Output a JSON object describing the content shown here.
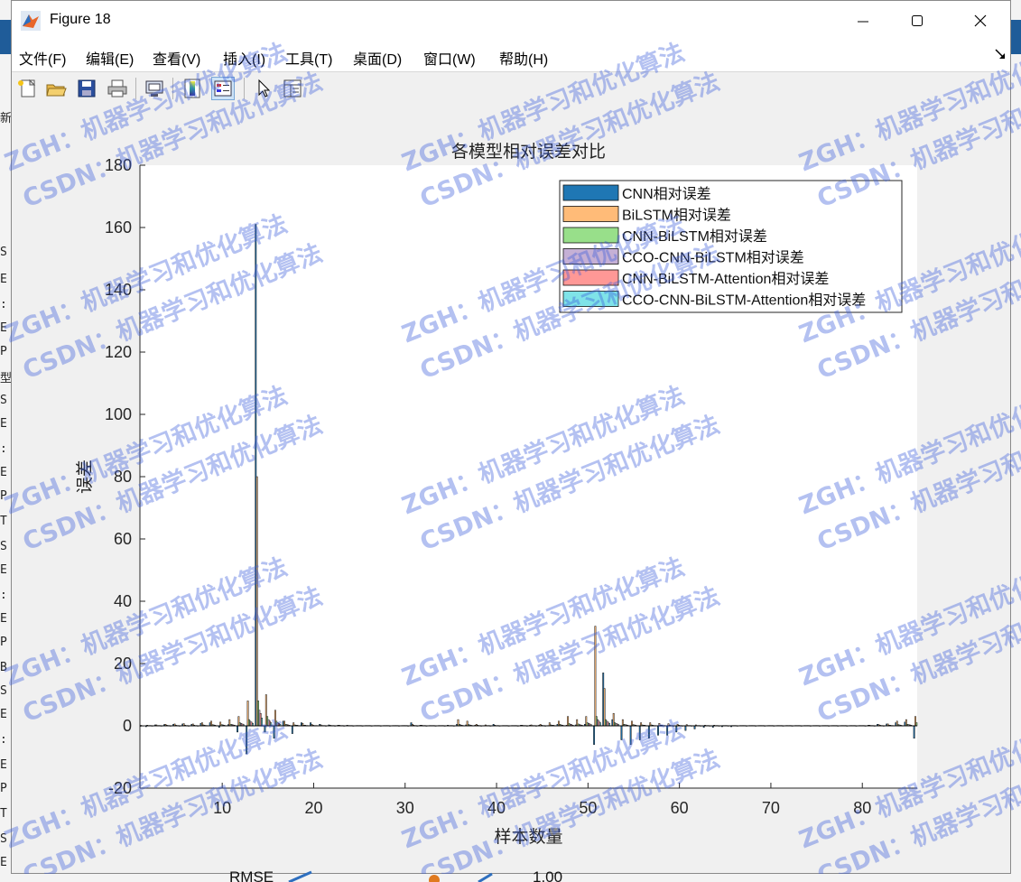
{
  "window": {
    "title": "Figure 18",
    "icon": "matlab-logo-icon",
    "controls": [
      "minimize-icon",
      "maximize-icon",
      "close-icon"
    ]
  },
  "menu": [
    {
      "label": "文件(F)"
    },
    {
      "label": "编辑(E)"
    },
    {
      "label": "查看(V)"
    },
    {
      "label": "插入(I)"
    },
    {
      "label": "工具(T)"
    },
    {
      "label": "桌面(D)"
    },
    {
      "label": "窗口(W)"
    },
    {
      "label": "帮助(H)"
    }
  ],
  "toolbar": [
    "new-figure-icon",
    "open-file-icon",
    "save-icon",
    "print-icon",
    "link-plot-icon",
    "insert-colorbar-icon",
    "insert-legend-icon",
    "edit-plot-icon",
    "property-inspector-icon"
  ],
  "background": {
    "left_glyphs": [
      "新",
      "S",
      "E",
      ":",
      "E",
      "P",
      "型",
      "S",
      "E",
      ":",
      "E",
      "P",
      "T",
      "S",
      "E",
      ":",
      "E",
      "P",
      "B",
      "S",
      "E",
      ":",
      "E",
      "P",
      "T",
      "S",
      "E"
    ],
    "bottom_text": [
      "RMSE",
      "1.00"
    ]
  },
  "watermark": "ZGH：机器学习和优化算法",
  "watermark2": "CSDN：机器学习和优化算法",
  "colors": {
    "cnn": "#1f77b4",
    "bilstm": "#ffbb78",
    "cnn_bilstm": "#98df8a",
    "cco_cnn_bilstm": "#c5b0d5",
    "cnn_bilstm_att": "#ff9896",
    "cco_cnn_bilstm_att": "#7fe3e8",
    "watermark": "#3b5bdb"
  },
  "chart_data": {
    "type": "bar",
    "title": "各模型相对误差对比",
    "xlabel": "样本数量",
    "ylabel": "误差",
    "xlim": [
      1,
      86
    ],
    "ylim": [
      -20,
      180
    ],
    "xticks": [
      10,
      20,
      30,
      40,
      50,
      60,
      70,
      80
    ],
    "yticks": [
      -20,
      0,
      20,
      40,
      60,
      80,
      100,
      120,
      140,
      160,
      180
    ],
    "legend_position": "top-right",
    "grid": false,
    "series": [
      {
        "name": "CNN相对误差",
        "values": [
          -0.2,
          -0.3,
          0.3,
          0.4,
          0.5,
          0.6,
          0.5,
          0.8,
          1,
          -0.5,
          0.4,
          -2,
          -9,
          161,
          -2,
          -4,
          1.5,
          -2.5,
          1,
          1,
          0.5,
          0.3,
          0.2,
          0.2,
          0.1,
          0.1,
          0.1,
          0.1,
          0.1,
          0.1,
          1,
          0.2,
          0.1,
          0.1,
          0.2,
          0.5,
          0.3,
          0.2,
          0.1,
          0.5,
          0.1,
          0.1,
          0.2,
          0.2,
          0.2,
          0.1,
          0.5,
          0.2,
          0.3,
          0.5,
          -6,
          17,
          2,
          -4.5,
          -6,
          -4.5,
          -4,
          -3,
          -3,
          -2,
          -1.5,
          -1,
          -0.5,
          -0.5,
          -0.3,
          -0.3,
          0.1,
          0.1,
          0.1,
          0.1,
          0.1,
          0.1,
          0.1,
          0.1,
          0.1,
          0.1,
          0.1,
          0.1,
          0.1,
          0.1,
          0.2,
          0.5,
          0.6,
          1,
          1.2,
          -4
        ]
      },
      {
        "name": "BiLSTM相对误差",
        "values": [
          0.2,
          0.2,
          0.3,
          0.5,
          0.6,
          0.7,
          0.6,
          1,
          1.5,
          1.2,
          2,
          3,
          8,
          80,
          10,
          5,
          1.5,
          1,
          0.8,
          0.5,
          0.3,
          0.2,
          0.2,
          0.1,
          0.1,
          0.1,
          0.1,
          0.1,
          0.1,
          0.1,
          0.5,
          0.2,
          0.1,
          0.1,
          0.1,
          2,
          1.5,
          0.5,
          0.3,
          0.2,
          0.1,
          0.1,
          0.2,
          0.3,
          0.5,
          1,
          1.5,
          3,
          2,
          3,
          32,
          12,
          4,
          2,
          1.5,
          1,
          1,
          0.8,
          0.7,
          0.5,
          0.4,
          0.3,
          0.2,
          0.2,
          0.1,
          0.1,
          0.1,
          0.1,
          0.1,
          0.1,
          0.1,
          0.1,
          0.1,
          0.1,
          0.1,
          0.1,
          0.1,
          0.1,
          0.1,
          0.1,
          0.2,
          0.4,
          0.6,
          1.5,
          2,
          3
        ]
      },
      {
        "name": "CNN-BiLSTM相对误差",
        "values": [
          0.1,
          0.1,
          0.1,
          0.2,
          0.2,
          0.2,
          0.2,
          0.3,
          0.4,
          0.4,
          0.5,
          1,
          2,
          8,
          3,
          1.5,
          0.5,
          0.3,
          0.2,
          0.2,
          0.1,
          0.1,
          0.1,
          0.1,
          0.1,
          0.1,
          0.1,
          0.1,
          0.1,
          0.1,
          0.2,
          0.1,
          0.1,
          0.1,
          0.1,
          0.5,
          0.4,
          0.2,
          0.1,
          0.1,
          0.1,
          0.1,
          0.1,
          0.1,
          0.2,
          0.3,
          0.5,
          0.8,
          0.6,
          1,
          3,
          2,
          1,
          0.5,
          0.4,
          0.3,
          0.3,
          0.2,
          0.2,
          0.2,
          0.1,
          0.1,
          0.1,
          0.1,
          0.1,
          0.1,
          0.1,
          0.1,
          0.1,
          0.1,
          0.1,
          0.1,
          0.1,
          0.1,
          0.1,
          0.1,
          0.1,
          0.1,
          0.1,
          0.1,
          0.1,
          0.2,
          0.2,
          0.4,
          0.5,
          1
        ]
      },
      {
        "name": "CCO-CNN-BiLSTM相对误差",
        "values": [
          0.1,
          0.1,
          0.1,
          0.1,
          0.1,
          0.1,
          0.1,
          0.2,
          0.3,
          0.3,
          0.4,
          0.8,
          1.5,
          5,
          2,
          1,
          0.4,
          0.2,
          0.2,
          0.1,
          0.1,
          0.1,
          0.1,
          0.1,
          0.1,
          0.1,
          0.1,
          0.1,
          0.1,
          0.1,
          0.1,
          0.1,
          0.1,
          0.1,
          0.1,
          0.3,
          0.3,
          0.1,
          0.1,
          0.1,
          0.1,
          0.1,
          0.1,
          0.1,
          0.1,
          0.2,
          0.3,
          0.5,
          0.4,
          0.8,
          2,
          1.5,
          0.8,
          0.4,
          0.3,
          0.2,
          0.2,
          0.2,
          0.1,
          0.1,
          0.1,
          0.1,
          0.1,
          0.1,
          0.1,
          0.1,
          0.1,
          0.1,
          0.1,
          0.1,
          0.1,
          0.1,
          0.1,
          0.1,
          0.1,
          0.1,
          0.1,
          0.1,
          0.1,
          0.1,
          0.1,
          0.1,
          0.2,
          0.3,
          0.4,
          0.8
        ]
      },
      {
        "name": "CNN-BiLSTM-Attention相对误差",
        "values": [
          0.1,
          0.1,
          0.1,
          0.1,
          0.1,
          0.1,
          0.1,
          0.1,
          0.2,
          0.2,
          0.3,
          0.6,
          1.2,
          4,
          1.5,
          0.8,
          0.3,
          0.2,
          0.1,
          0.1,
          0.1,
          0.1,
          0.1,
          0.1,
          0.1,
          0.1,
          0.1,
          0.1,
          0.1,
          0.1,
          0.1,
          0.1,
          0.1,
          0.1,
          0.1,
          0.2,
          0.2,
          0.1,
          0.1,
          0.1,
          0.1,
          0.1,
          0.1,
          0.1,
          0.1,
          0.2,
          0.2,
          0.4,
          0.3,
          0.6,
          1.5,
          1.2,
          0.6,
          0.3,
          0.2,
          0.2,
          0.1,
          0.1,
          0.1,
          0.1,
          0.1,
          0.1,
          0.1,
          0.1,
          0.1,
          0.1,
          0.1,
          0.1,
          0.1,
          0.1,
          0.1,
          0.1,
          0.1,
          0.1,
          0.1,
          0.1,
          0.1,
          0.1,
          0.1,
          0.1,
          0.1,
          0.1,
          0.1,
          0.2,
          0.3,
          0.6
        ]
      },
      {
        "name": "CCO-CNN-BiLSTM-Attention相对误差",
        "values": [
          0.05,
          0.05,
          0.05,
          0.05,
          0.05,
          0.05,
          0.05,
          0.1,
          0.1,
          0.1,
          0.2,
          0.4,
          0.8,
          2.5,
          1,
          0.5,
          0.2,
          0.1,
          0.1,
          0.1,
          0.05,
          0.05,
          0.05,
          0.05,
          0.05,
          0.05,
          0.05,
          0.05,
          0.05,
          0.05,
          0.05,
          0.05,
          0.05,
          0.05,
          0.05,
          0.1,
          0.1,
          0.05,
          0.05,
          0.05,
          0.05,
          0.05,
          0.05,
          0.05,
          0.05,
          0.1,
          0.1,
          0.2,
          0.2,
          0.4,
          1,
          0.8,
          0.4,
          0.2,
          0.1,
          0.1,
          0.1,
          0.1,
          0.05,
          0.05,
          0.05,
          0.05,
          0.05,
          0.05,
          0.05,
          0.05,
          0.05,
          0.05,
          0.05,
          0.05,
          0.05,
          0.05,
          0.05,
          0.05,
          0.05,
          0.05,
          0.05,
          0.05,
          0.05,
          0.05,
          0.05,
          0.05,
          0.1,
          0.1,
          0.2,
          0.4
        ]
      }
    ]
  }
}
